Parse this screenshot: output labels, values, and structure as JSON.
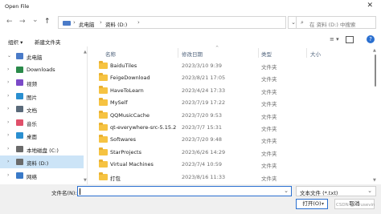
{
  "window": {
    "title": "Open File",
    "close_glyph": "✕"
  },
  "nav": {
    "back": "←",
    "forward": "→",
    "down": "⌄",
    "up": "↑",
    "breadcrumb": [
      "此电脑",
      "资料 (D:)"
    ],
    "crumb_sep": "›",
    "refresh": "↻",
    "dropdown": "⌄",
    "search_placeholder": "在 资料 (D:) 中搜索"
  },
  "commands": {
    "organize": "组织 ▾",
    "new_folder": "新建文件夹",
    "view": "≡ ▾",
    "help": "?"
  },
  "sidebar": {
    "items": [
      {
        "label": "此电脑",
        "chevron": "⌄",
        "icon": "pc-icon",
        "color": "#4a7bc8"
      },
      {
        "label": "Downloads",
        "chevron": "›",
        "icon": "download-icon",
        "color": "#2a8a4a"
      },
      {
        "label": "视频",
        "chevron": "›",
        "icon": "video-icon",
        "color": "#7b4ac8"
      },
      {
        "label": "图片",
        "chevron": "›",
        "icon": "picture-icon",
        "color": "#2a8fd0"
      },
      {
        "label": "文档",
        "chevron": "›",
        "icon": "document-icon",
        "color": "#5a6a7a"
      },
      {
        "label": "音乐",
        "chevron": "›",
        "icon": "music-icon",
        "color": "#e0506a"
      },
      {
        "label": "桌面",
        "chevron": "›",
        "icon": "desktop-icon",
        "color": "#2a8fd0"
      },
      {
        "label": "本地磁盘 (C:)",
        "chevron": "›",
        "icon": "drive-icon",
        "color": "#6a6a6a"
      },
      {
        "label": "资料 (D:)",
        "chevron": "›",
        "icon": "drive-icon",
        "color": "#6a6a6a"
      },
      {
        "label": "网络",
        "chevron": "›",
        "icon": "network-icon",
        "color": "#3a7ac8"
      }
    ],
    "selected_index": 8
  },
  "columns": {
    "name": "名称",
    "date": "修改日期",
    "type": "类型",
    "size": "大小",
    "sort_arrow": "^"
  },
  "files": [
    {
      "name": "BaiduTiles",
      "date": "2023/3/10 9:39",
      "type": "文件夹"
    },
    {
      "name": "FeigeDownload",
      "date": "2023/8/21 17:05",
      "type": "文件夹"
    },
    {
      "name": "HaveToLearn",
      "date": "2023/4/24 17:33",
      "type": "文件夹"
    },
    {
      "name": "MySelf",
      "date": "2023/7/19 17:22",
      "type": "文件夹"
    },
    {
      "name": "QQMusicCache",
      "date": "2023/7/20 9:53",
      "type": "文件夹"
    },
    {
      "name": "qt-everywhere-src-5.15.2",
      "date": "2023/7/7 15:31",
      "type": "文件夹"
    },
    {
      "name": "Softwares",
      "date": "2023/7/20 9:48",
      "type": "文件夹"
    },
    {
      "name": "StarProjects",
      "date": "2023/6/26 14:29",
      "type": "文件夹"
    },
    {
      "name": "Virtual Machines",
      "date": "2023/7/4 10:59",
      "type": "文件夹"
    },
    {
      "name": "打包",
      "date": "2023/8/16 11:33",
      "type": "文件夹"
    }
  ],
  "footer": {
    "filename_label": "文件名(N):",
    "filename_value": "",
    "filter_value": "文本文件 (*.txt)",
    "open_label": "打开(O)",
    "cancel_label": "取消",
    "watermark": "CSDN @forusevin"
  },
  "colors": {
    "accent": "#2a6fd0",
    "selection": "#cce4f7",
    "folder": "#f6c342"
  }
}
